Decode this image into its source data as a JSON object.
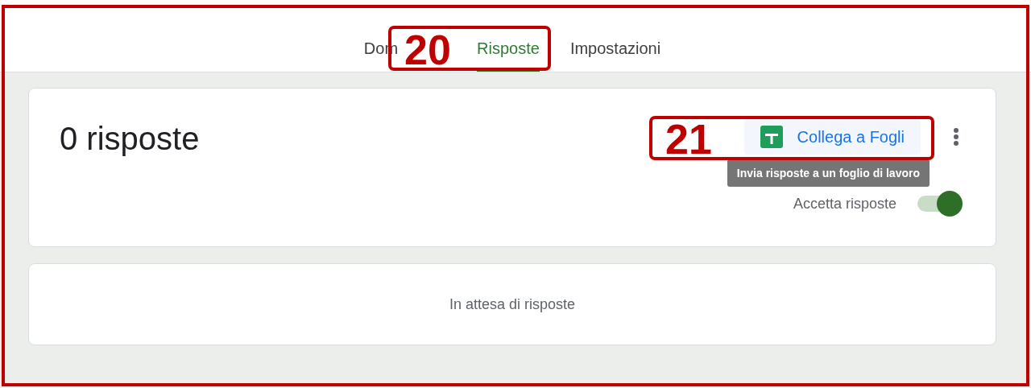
{
  "tabs": [
    {
      "label": "Dom",
      "selected": false
    },
    {
      "label": "Risposte",
      "selected": true
    },
    {
      "label": "Impostazioni",
      "selected": false
    }
  ],
  "summary": {
    "title": "0 risposte",
    "sheets_button": "Collega a Fogli",
    "tooltip": "Invia risposte a un foglio di lavoro",
    "accept_label": "Accetta risposte",
    "accept_on": true
  },
  "empty_message": "In attesa di risposte",
  "callouts": [
    {
      "number": "20"
    },
    {
      "number": "21"
    }
  ]
}
